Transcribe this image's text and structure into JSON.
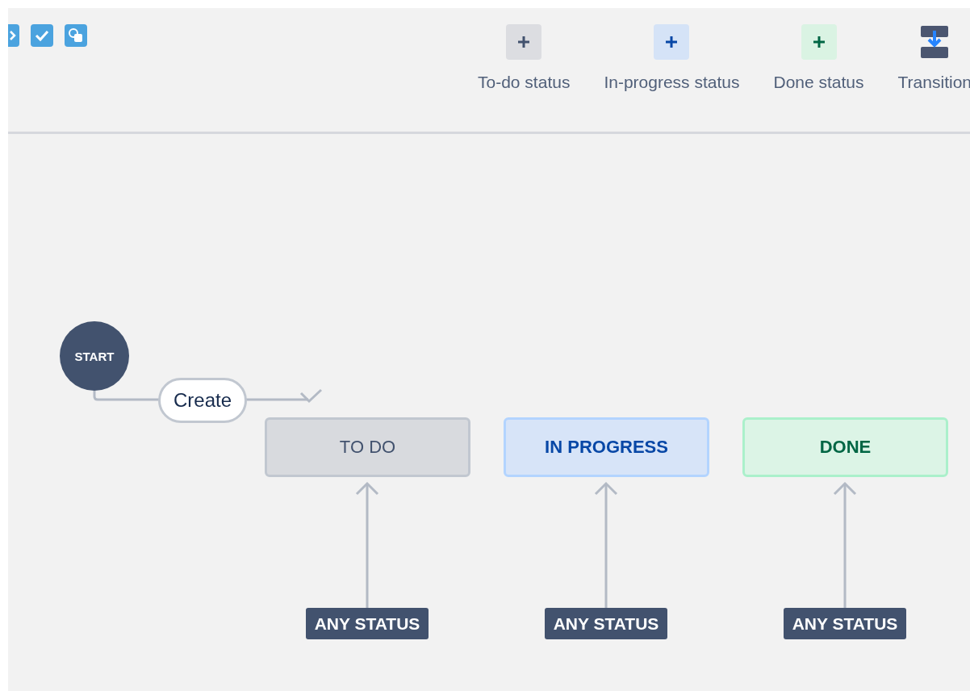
{
  "toolbar": {
    "tools": [
      {
        "kind": "code"
      },
      {
        "kind": "check"
      },
      {
        "kind": "shapes"
      }
    ],
    "buttons": [
      {
        "kind": "todo",
        "label": "To-do status"
      },
      {
        "kind": "inprogress",
        "label": "In-progress status"
      },
      {
        "kind": "done",
        "label": "Done status"
      },
      {
        "kind": "transition",
        "label": "Transition"
      }
    ]
  },
  "diagram": {
    "start": {
      "label": "START"
    },
    "initial_transition": {
      "label": "Create"
    },
    "statuses": [
      {
        "kind": "todo",
        "label": "TO DO",
        "incoming": {
          "label": "ANY STATUS"
        }
      },
      {
        "kind": "inprogress",
        "label": "IN PROGRESS",
        "incoming": {
          "label": "ANY STATUS"
        }
      },
      {
        "kind": "done",
        "label": "DONE",
        "incoming": {
          "label": "ANY STATUS"
        }
      }
    ]
  }
}
